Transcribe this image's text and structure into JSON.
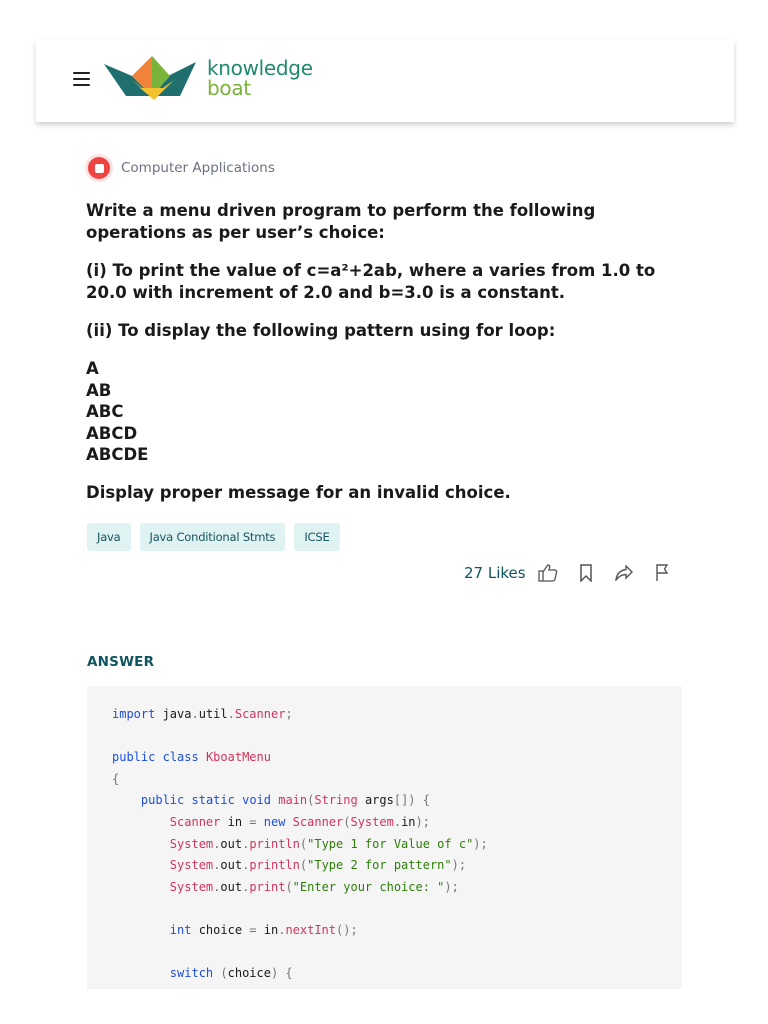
{
  "header": {
    "logo_line1": "knowledge",
    "logo_line2": "boat"
  },
  "category": {
    "label": "Computer Applications"
  },
  "question": {
    "intro": "Write a menu driven program to perform the following operations as per user’s choice:",
    "part1": "(i) To print the value of c=a²+2ab, where a varies from 1.0 to 20.0 with increment of 2.0 and b=3.0 is a constant.",
    "part2": "(ii) To display the following pattern using for loop:",
    "pattern": [
      "A",
      "AB",
      "ABC",
      "ABCD",
      "ABCDE"
    ],
    "closing": "Display proper message for an invalid choice."
  },
  "tags": [
    "Java",
    "Java Conditional Stmts",
    "ICSE"
  ],
  "actions": {
    "likes": "27 Likes"
  },
  "icons": [
    "menu-icon",
    "thumbs-up-icon",
    "bookmark-icon",
    "share-icon",
    "flag-icon",
    "category-icon"
  ],
  "answer": {
    "label": "ANSWER",
    "code": [
      [
        [
          "kw",
          "import"
        ],
        [
          "id",
          " java"
        ],
        [
          "pn",
          "."
        ],
        [
          "id",
          "util"
        ],
        [
          "pn",
          "."
        ],
        [
          "ty",
          "Scanner"
        ],
        [
          "pn",
          ";"
        ]
      ],
      [],
      [
        [
          "kw",
          "public"
        ],
        [
          "id",
          " "
        ],
        [
          "kw",
          "class"
        ],
        [
          "id",
          " "
        ],
        [
          "ty",
          "KboatMenu"
        ]
      ],
      [
        [
          "pn",
          "{"
        ]
      ],
      [
        [
          "id",
          "    "
        ],
        [
          "kw",
          "public"
        ],
        [
          "id",
          " "
        ],
        [
          "kw",
          "static"
        ],
        [
          "id",
          " "
        ],
        [
          "kw",
          "void"
        ],
        [
          "id",
          " "
        ],
        [
          "ty",
          "main"
        ],
        [
          "pn",
          "("
        ],
        [
          "ty",
          "String"
        ],
        [
          "id",
          " args"
        ],
        [
          "pn",
          "[]) {"
        ]
      ],
      [
        [
          "id",
          "        "
        ],
        [
          "ty",
          "Scanner"
        ],
        [
          "id",
          " in "
        ],
        [
          "pn",
          "="
        ],
        [
          "id",
          " "
        ],
        [
          "kw",
          "new"
        ],
        [
          "id",
          " "
        ],
        [
          "ty",
          "Scanner"
        ],
        [
          "pn",
          "("
        ],
        [
          "ty",
          "System"
        ],
        [
          "pn",
          "."
        ],
        [
          "id",
          "in"
        ],
        [
          "pn",
          ");"
        ]
      ],
      [
        [
          "id",
          "        "
        ],
        [
          "ty",
          "System"
        ],
        [
          "pn",
          "."
        ],
        [
          "id",
          "out"
        ],
        [
          "pn",
          "."
        ],
        [
          "ty",
          "println"
        ],
        [
          "pn",
          "("
        ],
        [
          "st",
          "\"Type 1 for Value of c\""
        ],
        [
          "pn",
          ");"
        ]
      ],
      [
        [
          "id",
          "        "
        ],
        [
          "ty",
          "System"
        ],
        [
          "pn",
          "."
        ],
        [
          "id",
          "out"
        ],
        [
          "pn",
          "."
        ],
        [
          "ty",
          "println"
        ],
        [
          "pn",
          "("
        ],
        [
          "st",
          "\"Type 2 for pattern\""
        ],
        [
          "pn",
          ");"
        ]
      ],
      [
        [
          "id",
          "        "
        ],
        [
          "ty",
          "System"
        ],
        [
          "pn",
          "."
        ],
        [
          "id",
          "out"
        ],
        [
          "pn",
          "."
        ],
        [
          "ty",
          "print"
        ],
        [
          "pn",
          "("
        ],
        [
          "st",
          "\"Enter your choice: \""
        ],
        [
          "pn",
          ");"
        ]
      ],
      [],
      [
        [
          "id",
          "        "
        ],
        [
          "kw",
          "int"
        ],
        [
          "id",
          " choice "
        ],
        [
          "pn",
          "="
        ],
        [
          "id",
          " in"
        ],
        [
          "pn",
          "."
        ],
        [
          "ty",
          "nextInt"
        ],
        [
          "pn",
          "();"
        ]
      ],
      [],
      [
        [
          "id",
          "        "
        ],
        [
          "kw",
          "switch"
        ],
        [
          "id",
          " "
        ],
        [
          "pn",
          "("
        ],
        [
          "id",
          "choice"
        ],
        [
          "pn",
          ") {"
        ]
      ]
    ]
  },
  "colors": {
    "brand_teal": "#1f8a70",
    "brand_green": "#7ab33a",
    "category_red": "#ef4444",
    "tag_bg": "#dff3f3",
    "answer_label": "#0f5560",
    "code_bg": "#f5f5f5"
  }
}
